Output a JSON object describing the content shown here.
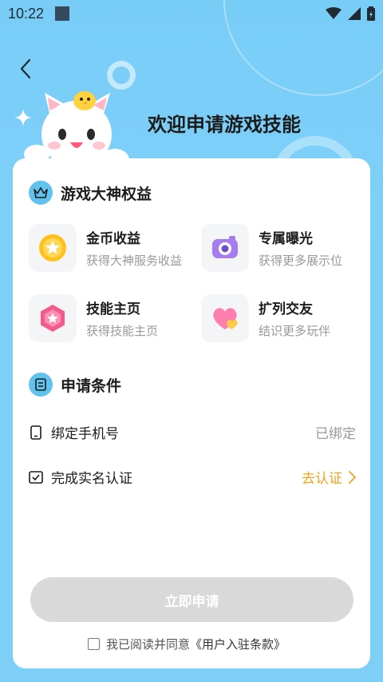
{
  "status_bar": {
    "time": "10:22"
  },
  "header": {
    "title": "欢迎申请游戏技能"
  },
  "benefits": {
    "title": "游戏大神权益",
    "items": [
      {
        "name": "金币收益",
        "desc": "获得大神服务收益"
      },
      {
        "name": "专属曝光",
        "desc": "获得更多展示位"
      },
      {
        "name": "技能主页",
        "desc": "获得技能主页"
      },
      {
        "name": "扩列交友",
        "desc": "结识更多玩伴"
      }
    ]
  },
  "conditions": {
    "title": "申请条件",
    "items": [
      {
        "label": "绑定手机号",
        "status": "已绑定"
      },
      {
        "label": "完成实名认证",
        "action": "去认证"
      }
    ]
  },
  "apply_button": "立即申请",
  "agreement": {
    "prefix": "我已阅读并同意",
    "link": "《用户入驻条款》"
  },
  "colors": {
    "background": "#7ecff7",
    "accent": "#62c2ee",
    "action": "#f5a21b",
    "disabled_button": "#d9d9d9"
  }
}
